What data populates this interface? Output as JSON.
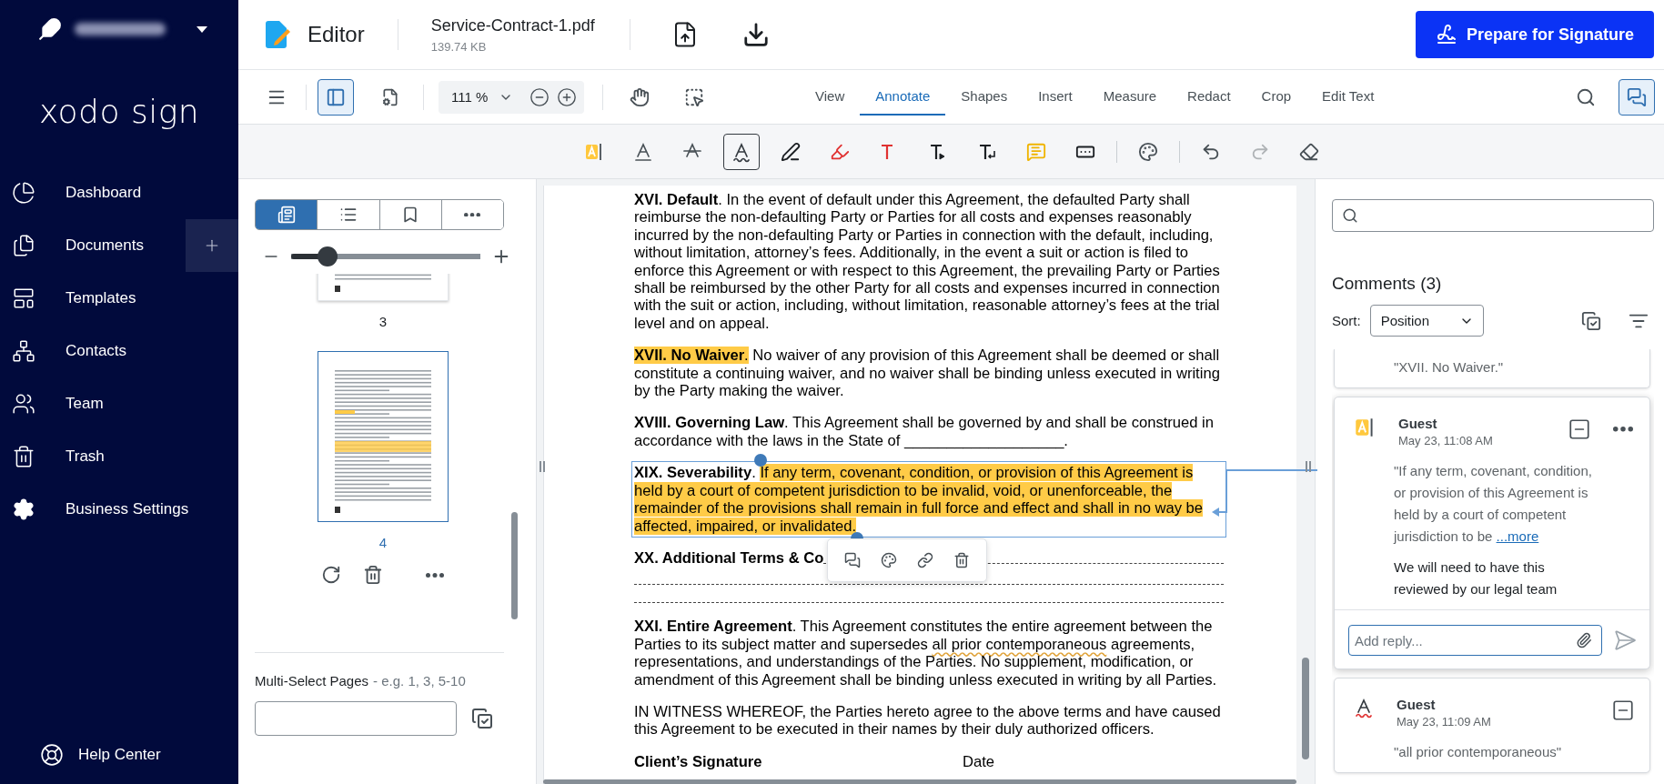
{
  "sidebar": {
    "logo": "xodo sign",
    "nav": [
      {
        "label": "Dashboard",
        "add_button": false
      },
      {
        "label": "Documents",
        "add_button": true
      },
      {
        "label": "Templates",
        "add_button": false
      },
      {
        "label": "Contacts",
        "add_button": false
      },
      {
        "label": "Team",
        "add_button": false
      },
      {
        "label": "Trash",
        "add_button": false
      },
      {
        "label": "Business Settings",
        "add_button": false
      }
    ],
    "help": "Help Center"
  },
  "topbar": {
    "app": "Editor",
    "file_name": "Service-Contract-1.pdf",
    "file_size": "139.74 KB",
    "primary_button": "Prepare for Signature"
  },
  "toolbar": {
    "sidebar_toggle_selected": true,
    "zoom": "111 %",
    "comments_toggle_selected": true,
    "tabs": [
      {
        "label": "View",
        "selected": false
      },
      {
        "label": "Annotate",
        "selected": true
      },
      {
        "label": "Shapes",
        "selected": false
      },
      {
        "label": "Insert",
        "selected": false
      },
      {
        "label": "Measure",
        "selected": false
      },
      {
        "label": "Redact",
        "selected": false
      },
      {
        "label": "Crop",
        "selected": false
      },
      {
        "label": "Edit Text",
        "selected": false
      }
    ]
  },
  "annotation_tools": [
    [
      {
        "kind": "highlight",
        "selected": false,
        "disabled": false
      },
      {
        "kind": "underline",
        "selected": false,
        "disabled": false
      },
      {
        "kind": "strikeout",
        "selected": false,
        "disabled": false
      },
      {
        "kind": "squiggly",
        "selected": true,
        "disabled": false
      },
      {
        "kind": "pen",
        "selected": false,
        "disabled": false
      },
      {
        "kind": "marker",
        "selected": false,
        "disabled": false
      },
      {
        "kind": "free-text",
        "selected": false,
        "disabled": false
      },
      {
        "kind": "insert-text",
        "selected": false,
        "disabled": false
      },
      {
        "kind": "replace-text",
        "selected": false,
        "disabled": false
      },
      {
        "kind": "note",
        "selected": false,
        "disabled": false
      },
      {
        "kind": "text-field",
        "selected": false,
        "disabled": false
      }
    ],
    [
      {
        "kind": "palette",
        "selected": false,
        "disabled": false
      }
    ],
    [
      {
        "kind": "undo",
        "selected": false,
        "disabled": false
      },
      {
        "kind": "redo",
        "selected": false,
        "disabled": true
      },
      {
        "kind": "eraser",
        "selected": false,
        "disabled": false
      }
    ]
  ],
  "left_panel": {
    "view_tabs": [
      {
        "kind": "thumbnails",
        "selected": true
      },
      {
        "kind": "outline",
        "selected": false
      },
      {
        "kind": "bookmarks",
        "selected": false
      },
      {
        "kind": "more",
        "selected": false
      }
    ],
    "thumbnail_zoom": {
      "level": 0.19
    },
    "pages": [
      {
        "number": "3",
        "selected": false
      },
      {
        "number": "4",
        "selected": true
      }
    ],
    "multi_select_label": "Multi-Select Pages",
    "multi_select_hint": "- e.g. 1, 3, 5-10"
  },
  "document": {
    "paragraphs": [
      {
        "kind": "text",
        "selected": false,
        "segments": [
          {
            "kind": "bold",
            "text": "XVI. Default",
            "highlighted": false
          },
          {
            "kind": "plain",
            "text": ". In the event of default under this Agreement, the defaulted Party shall reimburse the non-defaulting Party or Parties for all costs and expenses reasonably incurred by the non-defaulting Party or Parties in connection with the default, including, without limitation, attorney’s fees. Additionally, in the event a suit or action is filed to enforce this Agreement or with respect to this Agreement, the prevailing Party or Parties shall be reimbursed by the other Party for all costs and expenses incurred in connection with the suit or action, including, without limitation, reasonable attorney’s fees at the trial level and on appeal.",
            "highlighted": false
          }
        ]
      },
      {
        "kind": "text",
        "selected": false,
        "segments": [
          {
            "kind": "bold",
            "text": "XVII. No Waiver",
            "highlighted": true
          },
          {
            "kind": "plain",
            "text": ".",
            "highlighted": true
          },
          {
            "kind": "plain",
            "text": " No waiver of any provision of this Agreement shall be deemed or shall constitute a continuing waiver, and no waiver shall be binding unless executed in writing by the Party making the waiver.",
            "highlighted": false
          }
        ]
      },
      {
        "kind": "text",
        "selected": false,
        "segments": [
          {
            "kind": "bold",
            "text": "XVIII. Governing Law",
            "highlighted": false
          },
          {
            "kind": "plain",
            "text": ". This Agreement shall be governed by and shall be construed in accordance with the laws in the State of ___________________.",
            "highlighted": false
          }
        ]
      },
      {
        "kind": "text",
        "selected": true,
        "segments": [
          {
            "kind": "bold",
            "text": "XIX. Severability",
            "highlighted": false
          },
          {
            "kind": "plain",
            "text": ". ",
            "highlighted": false
          },
          {
            "kind": "plain",
            "text": "If any term, covenant, condition, or provision of this Agreement is held by a court of competent jurisdiction to be invalid, void, or unenforceable, the remainder of the provisions shall remain in full force and effect and shall in no way be affected, impaired, or invalidated.",
            "highlighted": true
          }
        ]
      },
      {
        "kind": "fill-in",
        "selected": false,
        "segments": [
          {
            "kind": "bold",
            "text": "XX. Additional Terms & Co",
            "highlighted": false
          }
        ]
      },
      {
        "kind": "text",
        "selected": false,
        "segments": [
          {
            "kind": "bold",
            "text": "XXI. Entire Agreement",
            "highlighted": false
          },
          {
            "kind": "plain",
            "text": ". This Agreement constitutes the entire agreement between the Parties to its subject matter and supersedes ",
            "highlighted": false
          },
          {
            "kind": "squiggly",
            "text": "all prior contemporaneous",
            "highlighted": false
          },
          {
            "kind": "plain",
            "text": " agreements, representations, and understandings of the Parties. No supplement, modification, or amendment of this Agreement shall be binding unless executed in writing by all Parties.",
            "highlighted": false
          }
        ]
      },
      {
        "kind": "text",
        "selected": false,
        "segments": [
          {
            "kind": "plain",
            "text": "IN WITNESS WHEREOF, the Parties hereto agree to the above terms and have caused this Agreement to be executed in their names by their duly authorized officers.",
            "highlighted": false
          }
        ]
      },
      {
        "kind": "signature",
        "selected": false,
        "segments": [
          {
            "kind": "bold",
            "text": "Client’s Signature",
            "highlighted": false
          },
          {
            "kind": "plain",
            "text": "Date",
            "highlighted": false
          }
        ]
      }
    ]
  },
  "comments": {
    "title": "Comments (3)",
    "sort_label": "Sort:",
    "sort_value": "Position",
    "cards": [
      {
        "quote": "\"XVII. No Waiver.\"",
        "selected": false
      },
      {
        "kind": "highlight",
        "author": "Guest",
        "date": "May 23, 11:08 AM",
        "quote": "\"If any term, covenant, condition, or provision of this Agreement is held by a court of competent jurisdiction to be",
        "more": "...more",
        "reply": "We will need to have this reviewed by our legal team",
        "reply_placeholder": "Add reply...",
        "selected": true
      },
      {
        "kind": "squiggly",
        "author": "Guest",
        "date": "May 23, 11:09 AM",
        "quote": "\"all prior contemporaneous\"",
        "selected": false
      }
    ]
  }
}
